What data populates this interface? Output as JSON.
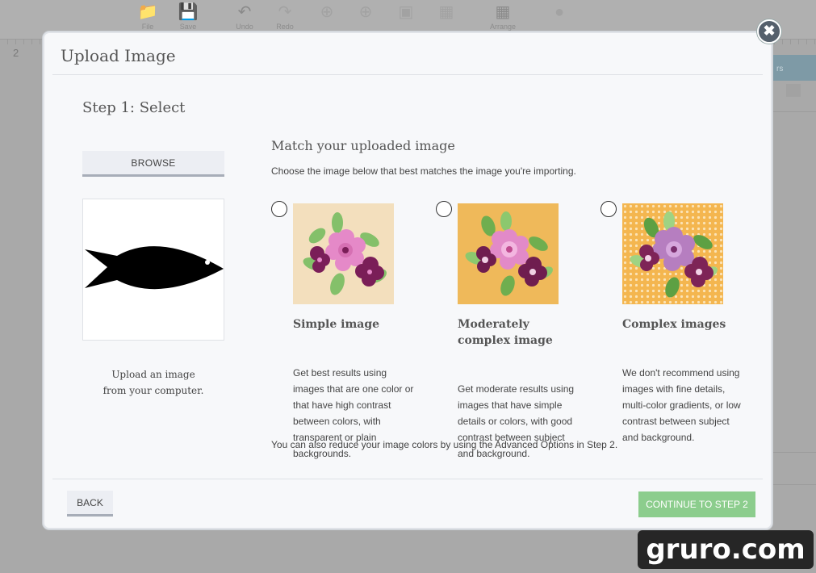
{
  "toolbar": {
    "items": [
      {
        "label": "File",
        "icon": "folder-icon"
      },
      {
        "label": "Save",
        "icon": "save-icon"
      },
      {
        "label": "Undo",
        "icon": "undo-icon"
      },
      {
        "label": "Redo",
        "icon": "redo-icon"
      },
      {
        "label": "",
        "icon": "group-icon"
      },
      {
        "label": "",
        "icon": "ungroup-icon"
      },
      {
        "label": "",
        "icon": "attach-icon"
      },
      {
        "label": "",
        "icon": "grid-icon"
      },
      {
        "label": "Arrange",
        "icon": "arrange-icon"
      },
      {
        "label": "",
        "icon": "account-icon"
      }
    ]
  },
  "ruler": {
    "number": "2"
  },
  "side_panel": {
    "label": "rs"
  },
  "modal": {
    "title": "Upload Image",
    "close_label": "✖",
    "step_title": "Step 1: Select",
    "browse_label": "BROWSE",
    "upload_hint_line1": "Upload an image",
    "upload_hint_line2": "from your computer.",
    "match_title": "Match your uploaded image",
    "match_desc": "Choose the image below that best matches the image you're importing.",
    "options": [
      {
        "title_line1": "Simple image",
        "title_line2": "",
        "desc_lines": [
          "Get best results using",
          "images that are one color or",
          "that have high contrast",
          "between colors, with",
          "transparent or plain",
          "backgrounds."
        ]
      },
      {
        "title_line1": "Moderately",
        "title_line2": "complex image",
        "desc_lines": [
          "Get moderate results using",
          "images that have simple",
          "details or colors, with good",
          "contrast between subject",
          "and background."
        ]
      },
      {
        "title_line1": "Complex images",
        "title_line2": "",
        "desc_lines": [
          "We don't recommend using",
          "images with fine details,",
          "multi-color gradients, or low",
          "contrast between subject",
          "and background."
        ]
      }
    ],
    "reduce_note": "You can also reduce your image colors by using the Advanced Options in Step 2.",
    "back_label": "BACK",
    "continue_label": "CONTINUE TO STEP 2"
  },
  "colors": {
    "continue_green": "#8ccd8d",
    "simple_bg": "#f3dfbd",
    "moderate_bg": "#efb95a",
    "complex_bg": "#f4b64f",
    "petal_pink": "#e589c8",
    "plum": "#7a1e58",
    "leaf_green": "#84c06a"
  },
  "watermark": "gruro.com"
}
